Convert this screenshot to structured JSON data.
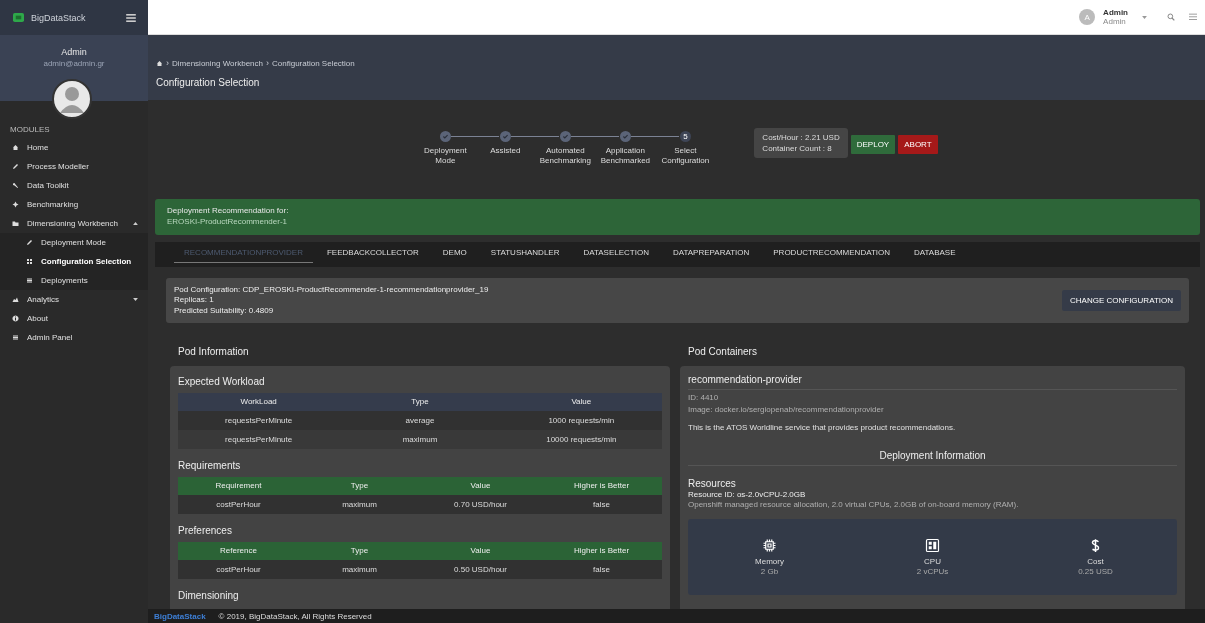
{
  "brand": {
    "name": "BigDataStack"
  },
  "profile": {
    "name": "Admin",
    "email": "admin@admin.gr"
  },
  "sidebar": {
    "section": "MODULES",
    "items": [
      {
        "label": "Home",
        "selected": false
      },
      {
        "label": "Process Modeller",
        "selected": false
      },
      {
        "label": "Data Toolkit",
        "selected": false
      },
      {
        "label": "Benchmarking",
        "selected": false
      },
      {
        "label": "Dimensioning Workbench",
        "selected": false,
        "expanded": true,
        "children": [
          {
            "label": "Deployment Mode",
            "selected": false
          },
          {
            "label": "Configuration Selection",
            "selected": true
          },
          {
            "label": "Deployments",
            "selected": false
          }
        ]
      },
      {
        "label": "Analytics",
        "selected": false,
        "expanded": false
      },
      {
        "label": "About",
        "selected": false
      },
      {
        "label": "Admin Panel",
        "selected": false
      }
    ]
  },
  "topbar": {
    "avatar": "A",
    "user": "Admin",
    "role": "Admin"
  },
  "header": {
    "separator": "›",
    "breadcrumb": [
      "Dimensioning Workbench",
      "Configuration Selection"
    ],
    "title": "Configuration Selection"
  },
  "stepper": [
    {
      "label": "Deployment Mode",
      "done": true
    },
    {
      "label": "Assisted",
      "done": true
    },
    {
      "label": "Automated Benchmarking",
      "done": true
    },
    {
      "label": "Application Benchmarked",
      "done": true
    },
    {
      "label": "Select Configuration",
      "done": false,
      "number": "5"
    }
  ],
  "summary": {
    "cost": "Cost/Hour : 2.21 USD",
    "count": "Container Count : 8"
  },
  "actions": [
    {
      "label": "DEPLOY",
      "kind": "deploy"
    },
    {
      "label": "ABORT",
      "kind": "abort"
    }
  ],
  "banner": {
    "title": "Deployment Recommendation for:",
    "name": "EROSKI-ProductRecommender-1"
  },
  "tabs": [
    {
      "label": "RECOMMENDATIONPROVIDER",
      "selected": true
    },
    {
      "label": "FEEDBACKCOLLECTOR",
      "selected": false
    },
    {
      "label": "DEMO",
      "selected": false
    },
    {
      "label": "STATUSHANDLER",
      "selected": false
    },
    {
      "label": "DATASELECTION",
      "selected": false
    },
    {
      "label": "DATAPREPARATION",
      "selected": false
    },
    {
      "label": "PRODUCTRECOMMENDATION",
      "selected": false
    },
    {
      "label": "DATABASE",
      "selected": false
    }
  ],
  "pod_config": {
    "lines": [
      "Pod Configuration: CDP_EROSKI-ProductRecommender-1-recommendationprovider_19",
      "Replicas: 1",
      "Predicted Suitability: 0.4809"
    ],
    "button": "CHANGE CONFIGURATION"
  },
  "pod_information": {
    "title": "Pod Information",
    "sections": [
      {
        "title": "Expected Workload",
        "kind": "workload",
        "columns": [
          "WorkLoad",
          "Type",
          "Value"
        ],
        "rows": [
          [
            "requestsPerMinute",
            "average",
            "1000 requests/min"
          ],
          [
            "requestsPerMinute",
            "maximum",
            "10000 requests/min"
          ]
        ]
      },
      {
        "title": "Requirements",
        "kind": "constraint",
        "columns": [
          "Requirement",
          "Type",
          "Value",
          "Higher is Better"
        ],
        "rows": [
          [
            "costPerHour",
            "maximum",
            "0.70 USD/hour",
            "false"
          ]
        ]
      },
      {
        "title": "Preferences",
        "kind": "constraint",
        "columns": [
          "Reference",
          "Type",
          "Value",
          "Higher is Better"
        ],
        "rows": [
          [
            "costPerHour",
            "maximum",
            "0.50 USD/hour",
            "false"
          ]
        ]
      },
      {
        "title": "Dimensioning",
        "kind": "heading"
      }
    ]
  },
  "pod_containers": {
    "title": "Pod Containers",
    "name": "recommendation-provider",
    "id": "ID: 4410",
    "image": "Image: docker.io/sergiopenab/recommendationprovider",
    "description": "This is the ATOS Worldline service that provides product recommendations.",
    "deployment_title": "Deployment Information",
    "resources_title": "Resources",
    "resource_id": "Resource ID: os-2.0vCPU-2.0GB",
    "resource_desc": "Openshift managed resource allocation, 2.0 virtual CPUs, 2.0GB of on-board memory (RAM).",
    "stats": [
      {
        "label": "Memory",
        "value": "2 Gb"
      },
      {
        "label": "CPU",
        "value": "2 vCPUs"
      },
      {
        "label": "Cost",
        "value": "0.25 USD"
      }
    ]
  },
  "footer": {
    "logo": "BigDataStack",
    "text": "© 2019, BigDataStack, All Rights Reserved"
  }
}
